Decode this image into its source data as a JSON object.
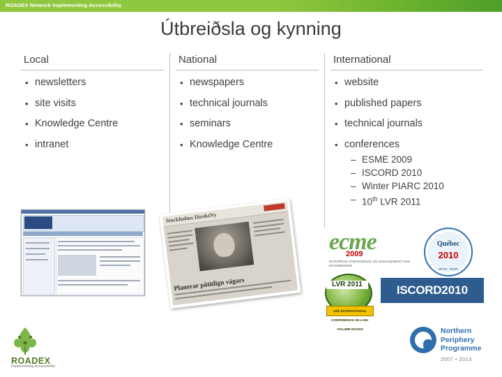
{
  "topbar": {
    "text": "ROADEX Network Implementing Accessibility",
    "color": "#8fc73e"
  },
  "title": "Útbreiðsla og kynning",
  "columns": [
    {
      "heading": "Local",
      "items": [
        {
          "text": "newsletters"
        },
        {
          "text": "site visits"
        },
        {
          "text": "Knowledge Centre"
        },
        {
          "text": "intranet"
        }
      ]
    },
    {
      "heading": "National",
      "items": [
        {
          "text": "newspapers"
        },
        {
          "text": "technical journals"
        },
        {
          "text": "seminars"
        },
        {
          "text": "Knowledge Centre"
        }
      ]
    },
    {
      "heading": "International",
      "items": [
        {
          "text": "website"
        },
        {
          "text": "published papers"
        },
        {
          "text": "technical journals"
        },
        {
          "text": "conferences",
          "sub": [
            {
              "text": "ESME 2009"
            },
            {
              "text": "ISCORD 2010"
            },
            {
              "text": "Winter PIARC 2010"
            },
            {
              "text": "10",
              "sup": "th",
              "tail": " LVR 2011"
            }
          ]
        }
      ]
    }
  ],
  "bullet_glyph": "•",
  "dash_glyph": "–",
  "images": {
    "website_screenshot": {
      "name": "knowledge-centre-website-screenshot"
    },
    "newspaper_clipping": {
      "name": "newspaper-clipping-photo",
      "masthead": "Stockholms DirektNy",
      "caption": "Planerar påtitlign vägars"
    }
  },
  "logos": {
    "ecme": {
      "word": "ecme",
      "year": "2009",
      "subtitle": "EUROPEAN CONFERENCE ON MANAGEMENT AND ENGINEERING"
    },
    "quebec": {
      "name": "Québec",
      "year": "2010",
      "subtitle": "AIPCR · PIARC"
    },
    "lvr": {
      "name": "LVR 2011",
      "ribbon": "10th INTERNATIONAL CONFERENCE ON LOW-VOLUME ROADS"
    },
    "iscord": {
      "name": "ISCORD",
      "year": "2010"
    },
    "roadex": {
      "word": "ROADEX",
      "tagline": "Implementing Accessibility"
    },
    "npp": {
      "line1": "Northern",
      "line2": "Periphery",
      "line3": "Programme",
      "years": "2007 • 2013"
    }
  }
}
